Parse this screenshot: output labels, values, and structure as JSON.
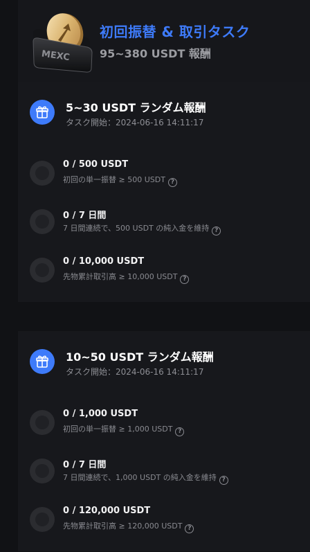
{
  "header": {
    "title": "初回振替 & 取引タスク",
    "subtitle": "95~380 USDT 報酬",
    "logo_text": "MEXC"
  },
  "tasks_groups": [
    {
      "title": "5~30 USDT ランダム報酬",
      "started": "タスク開始：2024-06-16 14:11:17",
      "tasks": [
        {
          "progress": "0 / 500 USDT",
          "requirement": "初回の単一振替 ≥ 500 USDT"
        },
        {
          "progress": "0 / 7 日間",
          "requirement": "7 日間連続で、500 USDT の純入金を維持"
        },
        {
          "progress": "0 / 10,000 USDT",
          "requirement": "先物累計取引高 ≥ 10,000 USDT"
        }
      ]
    },
    {
      "title": "10~50 USDT ランダム報酬",
      "started": "タスク開始：2024-06-16 14:11:17",
      "tasks": [
        {
          "progress": "0 / 1,000 USDT",
          "requirement": "初回の単一振替 ≥ 1,000 USDT"
        },
        {
          "progress": "0 / 7 日間",
          "requirement": "7 日間連続で、1,000 USDT の純入金を維持"
        },
        {
          "progress": "0 / 120,000 USDT",
          "requirement": "先物累計取引高 ≥ 120,000 USDT"
        }
      ]
    }
  ],
  "icons": {
    "header": "mexc-wallet-coin-icon",
    "card": "gift-icon",
    "task_status": "incomplete-circle-icon",
    "help": "question-circle-icon"
  },
  "colors": {
    "accent": "#3e7bfa",
    "background": "#111215",
    "card": "#17181c",
    "muted_text": "#8a8b91"
  }
}
